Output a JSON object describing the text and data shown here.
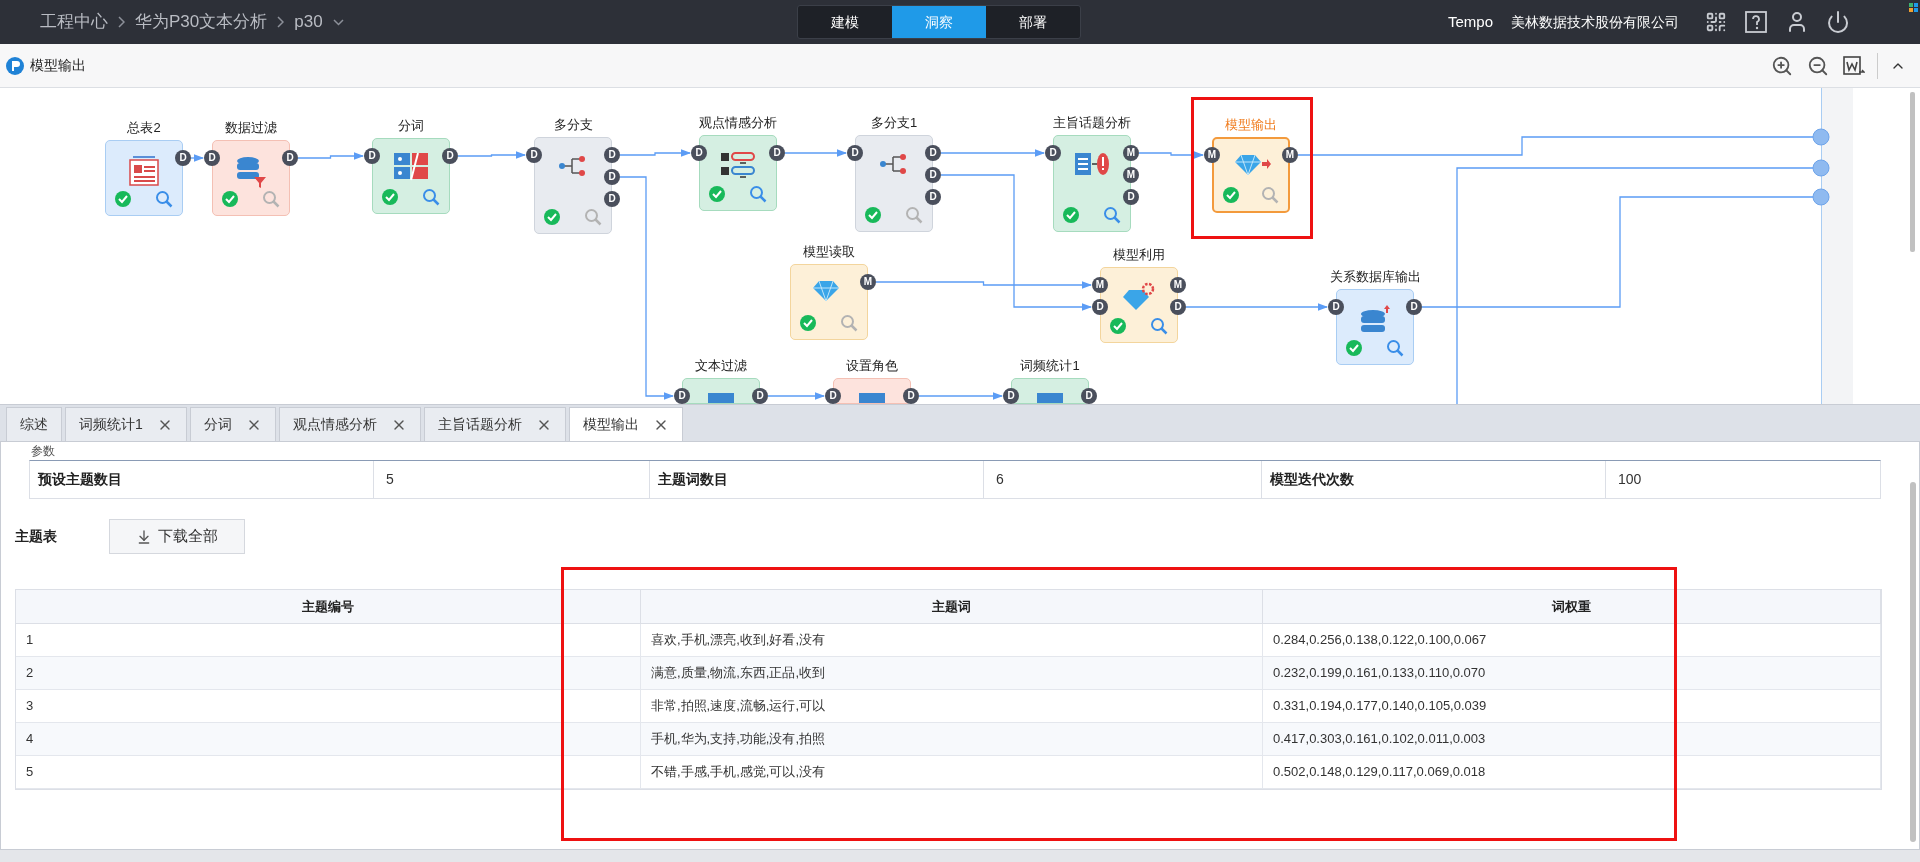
{
  "topbar": {
    "breadcrumb": [
      "工程中心",
      "华为P30文本分析",
      "p30"
    ],
    "modes": [
      {
        "label": "建模",
        "selected": false
      },
      {
        "label": "洞察",
        "selected": true
      },
      {
        "label": "部署",
        "selected": false
      }
    ],
    "user": "Tempo",
    "company": "美林数据技术股份有限公司"
  },
  "toolbar": {
    "title": "模型输出"
  },
  "canvas": {
    "nodes": [
      {
        "label": "总表2",
        "kind": "input",
        "selected": false,
        "highlighted": false,
        "outputs": [
          "D"
        ],
        "status": {
          "ok": true,
          "preview": true
        }
      },
      {
        "label": "数据过滤",
        "kind": "prep",
        "selected": false,
        "highlighted": false,
        "inputs": [
          "D"
        ],
        "outputs": [
          "D"
        ],
        "status": {
          "ok": true,
          "preview": false
        }
      },
      {
        "label": "分词",
        "kind": "text",
        "selected": false,
        "highlighted": false,
        "inputs": [
          "D"
        ],
        "outputs": [
          "D"
        ],
        "status": {
          "ok": true,
          "preview": true
        }
      },
      {
        "label": "多分支",
        "kind": "branch",
        "selected": false,
        "highlighted": false,
        "inputs": [
          "D"
        ],
        "outputs": [
          "D",
          "D",
          "D"
        ],
        "status": {
          "ok": true,
          "preview": false
        }
      },
      {
        "label": "观点情感分析",
        "kind": "text",
        "selected": false,
        "highlighted": false,
        "inputs": [
          "D"
        ],
        "outputs": [
          "D"
        ],
        "status": {
          "ok": true,
          "preview": true
        }
      },
      {
        "label": "多分支1",
        "kind": "branch",
        "selected": false,
        "highlighted": false,
        "inputs": [
          "D"
        ],
        "outputs": [
          "D",
          "D",
          "D"
        ],
        "status": {
          "ok": true,
          "preview": false
        }
      },
      {
        "label": "主旨话题分析",
        "kind": "text",
        "selected": false,
        "highlighted": false,
        "inputs": [
          "D"
        ],
        "outputs": [
          "M",
          "M",
          "D"
        ],
        "status": {
          "ok": true,
          "preview": true
        }
      },
      {
        "label": "模型输出",
        "kind": "model",
        "selected": true,
        "highlighted": true,
        "inputs": [
          "M"
        ],
        "outputs": [
          "M"
        ],
        "status": {
          "ok": true,
          "preview": false
        }
      },
      {
        "label": "模型读取",
        "kind": "model",
        "selected": false,
        "highlighted": false,
        "outputs": [
          "M"
        ],
        "status": {
          "ok": true,
          "preview": false
        }
      },
      {
        "label": "模型利用",
        "kind": "model",
        "selected": false,
        "highlighted": false,
        "inputs": [
          "M",
          "D"
        ],
        "outputs": [
          "M",
          "D"
        ],
        "status": {
          "ok": true,
          "preview": true
        }
      },
      {
        "label": "关系数据库输出",
        "kind": "input",
        "selected": false,
        "highlighted": false,
        "inputs": [
          "D"
        ],
        "outputs": [
          "D"
        ],
        "status": {
          "ok": true,
          "preview": true
        }
      },
      {
        "label": "文本过滤",
        "kind": "text",
        "selected": false,
        "highlighted": false,
        "inputs": [
          "D"
        ],
        "outputs": [
          "D"
        ]
      },
      {
        "label": "设置角色",
        "kind": "prep",
        "selected": false,
        "highlighted": false,
        "inputs": [
          "D"
        ],
        "outputs": [
          "D"
        ]
      },
      {
        "label": "词频统计1",
        "kind": "text",
        "selected": false,
        "highlighted": false,
        "inputs": [
          "D"
        ],
        "outputs": [
          "D"
        ]
      }
    ]
  },
  "tabs": [
    {
      "label": "综述",
      "closable": false,
      "selected": false
    },
    {
      "label": "词频统计1",
      "closable": true,
      "selected": false
    },
    {
      "label": "分词",
      "closable": true,
      "selected": false
    },
    {
      "label": "观点情感分析",
      "closable": true,
      "selected": false
    },
    {
      "label": "主旨话题分析",
      "closable": true,
      "selected": false
    },
    {
      "label": "模型输出",
      "closable": true,
      "selected": true
    }
  ],
  "params": {
    "legend": "参数",
    "items": [
      {
        "label": "预设主题数目",
        "value": "5"
      },
      {
        "label": "主题词数目",
        "value": "6"
      },
      {
        "label": "模型迭代次数",
        "value": "100"
      }
    ]
  },
  "topic_table": {
    "title": "主题表",
    "download_button": "下载全部",
    "highlighted": true,
    "columns": [
      "主题编号",
      "主题词",
      "词权重"
    ],
    "rows": [
      [
        "1",
        "喜欢,手机,漂亮,收到,好看,没有",
        "0.284,0.256,0.138,0.122,0.100,0.067"
      ],
      [
        "2",
        "满意,质量,物流,东西,正品,收到",
        "0.232,0.199,0.161,0.133,0.110,0.070"
      ],
      [
        "3",
        "非常,拍照,速度,流畅,运行,可以",
        "0.331,0.194,0.177,0.140,0.105,0.039"
      ],
      [
        "4",
        "手机,华为,支持,功能,没有,拍照",
        "0.417,0.303,0.161,0.102,0.011,0.003"
      ],
      [
        "5",
        "不错,手感,手机,感觉,可以,没有",
        "0.502,0.148,0.129,0.117,0.069,0.018"
      ]
    ]
  }
}
